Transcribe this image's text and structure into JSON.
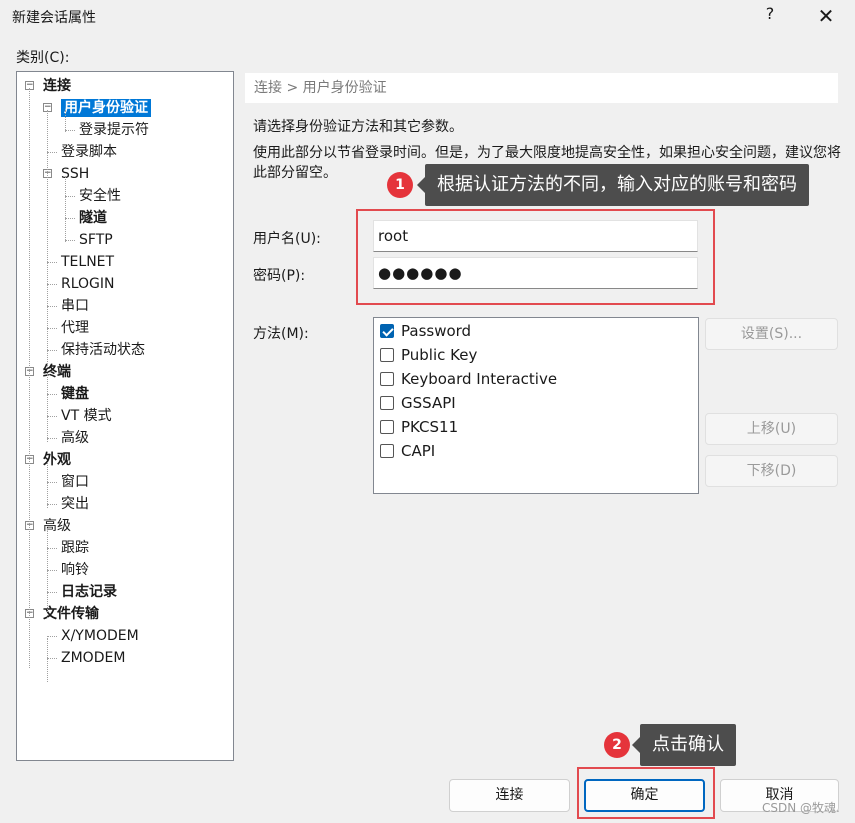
{
  "window": {
    "title": "新建会话属性",
    "help_glyph": "?",
    "close_glyph": "✕"
  },
  "category_label": "类别(C):",
  "tree": [
    {
      "label": "连接",
      "bold": true,
      "expander": "−"
    },
    {
      "label": "用户身份验证",
      "bold": true,
      "selected": true,
      "expander": "−"
    },
    {
      "label": "登录提示符"
    },
    {
      "label": "登录脚本"
    },
    {
      "label": "SSH",
      "expander": "−"
    },
    {
      "label": "安全性"
    },
    {
      "label": "隧道",
      "bold": true
    },
    {
      "label": "SFTP"
    },
    {
      "label": "TELNET"
    },
    {
      "label": "RLOGIN"
    },
    {
      "label": "串口"
    },
    {
      "label": "代理"
    },
    {
      "label": "保持活动状态"
    },
    {
      "label": "终端",
      "bold": true,
      "expander": "−"
    },
    {
      "label": "键盘",
      "bold": true
    },
    {
      "label": "VT 模式"
    },
    {
      "label": "高级"
    },
    {
      "label": "外观",
      "bold": true,
      "expander": "−"
    },
    {
      "label": "窗口"
    },
    {
      "label": "突出"
    },
    {
      "label": "高级",
      "expander": "−"
    },
    {
      "label": "跟踪"
    },
    {
      "label": "响铃"
    },
    {
      "label": "日志记录",
      "bold": true
    },
    {
      "label": "文件传输",
      "bold": true,
      "expander": "−"
    },
    {
      "label": "X/YMODEM"
    },
    {
      "label": "ZMODEM"
    }
  ],
  "panel": {
    "breadcrumb": "连接 > 用户身份验证",
    "desc1": "请选择身份验证方法和其它参数。",
    "desc2": "使用此部分以节省登录时间。但是，为了最大限度地提高安全性，如果担心安全问题，建议您将此部分留空。",
    "username_label": "用户名(U):",
    "username_value": "root",
    "password_label": "密码(P):",
    "password_value": "●●●●●●",
    "method_label": "方法(M):",
    "methods": [
      {
        "label": "Password",
        "checked": true
      },
      {
        "label": "Public Key",
        "checked": false
      },
      {
        "label": "Keyboard Interactive",
        "checked": false
      },
      {
        "label": "GSSAPI",
        "checked": false
      },
      {
        "label": "PKCS11",
        "checked": false
      },
      {
        "label": "CAPI",
        "checked": false
      }
    ],
    "settings_button": "设置(S)...",
    "move_up_button": "上移(U)",
    "move_down_button": "下移(D)"
  },
  "annotations": {
    "badge1": "1",
    "callout1": "根据认证方法的不同，输入对应的账号和密码",
    "badge2": "2",
    "callout2": "点击确认",
    "badge_color": "#e5343b",
    "highlight_color": "#e24a4f"
  },
  "footer": {
    "connect_button": "连接",
    "ok_button": "确定",
    "cancel_button": "取消"
  },
  "watermark": "CSDN @牧魂."
}
